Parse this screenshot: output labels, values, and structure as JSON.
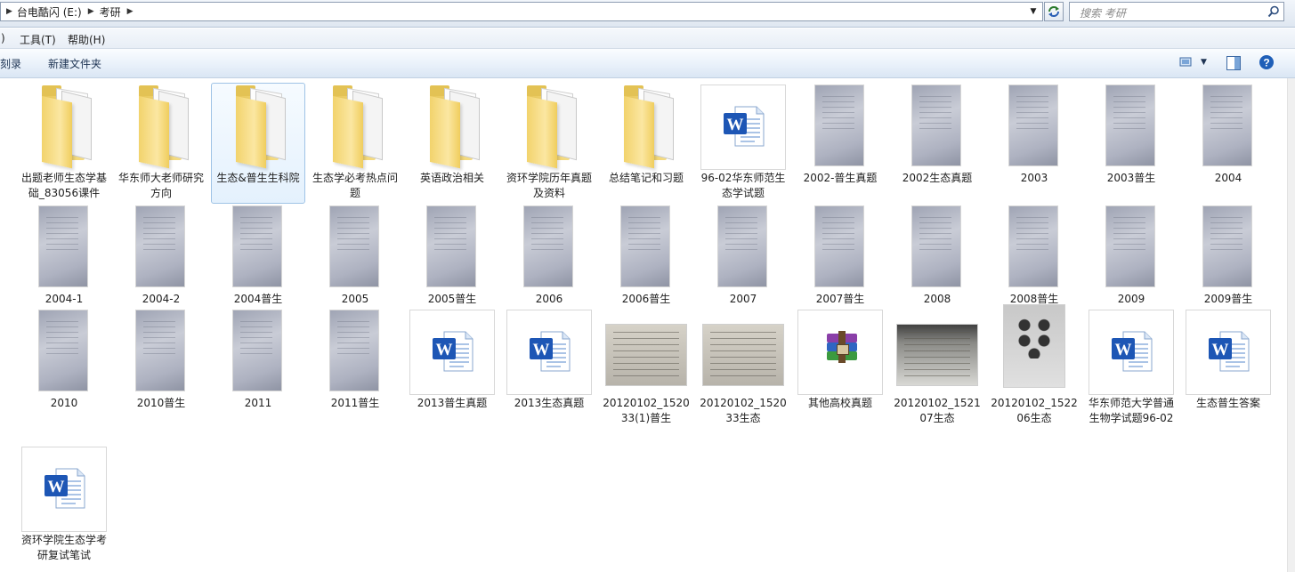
{
  "address": {
    "breadcrumbs": [
      "台电酷闪 (E:)",
      "考研"
    ]
  },
  "search": {
    "placeholder": "搜索 考研"
  },
  "menu": {
    "items": [
      {
        "label": ")"
      },
      {
        "label": "工具(T)"
      },
      {
        "label": "帮助(H)"
      }
    ]
  },
  "toolbar": {
    "burn_label": "刻录",
    "new_folder_label": "新建文件夹"
  },
  "items": [
    {
      "label": "出题老师生态学基础_83056课件",
      "type": "folder"
    },
    {
      "label": "华东师大老师研究方向",
      "type": "folder"
    },
    {
      "label": "生态&普生生科院",
      "type": "folder",
      "selected": true
    },
    {
      "label": "生态学必考热点问题",
      "type": "folder"
    },
    {
      "label": "英语政治相关",
      "type": "folder"
    },
    {
      "label": "资环学院历年真题及资料",
      "type": "folder"
    },
    {
      "label": "总结笔记和习题",
      "type": "folder"
    },
    {
      "label": "96-02华东师范生态学试题",
      "type": "word"
    },
    {
      "label": "2002-普生真题",
      "type": "photo"
    },
    {
      "label": "2002生态真题",
      "type": "photo"
    },
    {
      "label": "2003",
      "type": "photo"
    },
    {
      "label": "2003普生",
      "type": "photo"
    },
    {
      "label": "2004",
      "type": "photo"
    },
    {
      "label": "2004-1",
      "type": "photo"
    },
    {
      "label": "2004-2",
      "type": "photo"
    },
    {
      "label": "2004普生",
      "type": "photo"
    },
    {
      "label": "2005",
      "type": "photo"
    },
    {
      "label": "2005普生",
      "type": "photo"
    },
    {
      "label": "2006",
      "type": "photo"
    },
    {
      "label": "2006普生",
      "type": "photo"
    },
    {
      "label": "2007",
      "type": "photo"
    },
    {
      "label": "2007普生",
      "type": "photo"
    },
    {
      "label": "2008",
      "type": "photo"
    },
    {
      "label": "2008普生",
      "type": "photo"
    },
    {
      "label": "2009",
      "type": "photo"
    },
    {
      "label": "2009普生",
      "type": "photo"
    },
    {
      "label": "2010",
      "type": "photo"
    },
    {
      "label": "2010普生",
      "type": "photo"
    },
    {
      "label": "2011",
      "type": "photo"
    },
    {
      "label": "2011普生",
      "type": "photo"
    },
    {
      "label": "2013普生真题",
      "type": "word"
    },
    {
      "label": "2013生态真题",
      "type": "word"
    },
    {
      "label": "20120102_152033(1)普生",
      "type": "photo-land"
    },
    {
      "label": "20120102_152033生态",
      "type": "photo-land"
    },
    {
      "label": "其他高校真题",
      "type": "rar"
    },
    {
      "label": "20120102_152107生态",
      "type": "photo-land-dark"
    },
    {
      "label": "20120102_152206生态",
      "type": "photo-small"
    },
    {
      "label": "华东师范大学普通生物学试题96-02",
      "type": "word"
    },
    {
      "label": "生态普生答案",
      "type": "word"
    },
    {
      "label": "资环学院生态学考研复试笔试",
      "type": "word"
    }
  ]
}
